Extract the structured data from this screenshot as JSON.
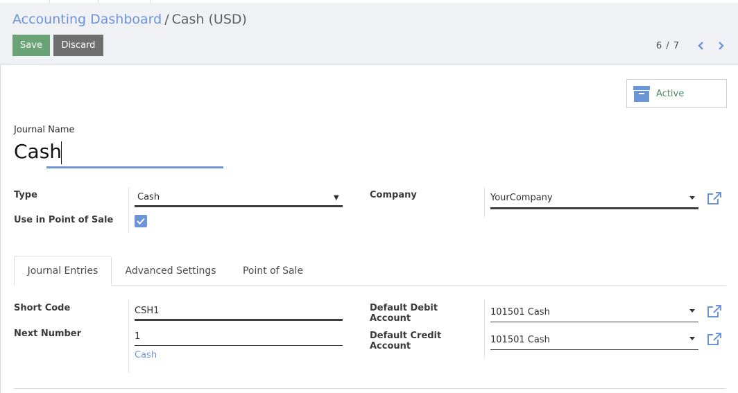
{
  "breadcrumb": {
    "parent": "Accounting Dashboard",
    "separator": "/",
    "current": "Cash (USD)"
  },
  "toolbar": {
    "save_label": "Save",
    "discard_label": "Discard"
  },
  "pager": {
    "value": "6 / 7",
    "prev_icon": "chevron-left-icon",
    "next_icon": "chevron-right-icon"
  },
  "status_button": {
    "label": "Active",
    "icon": "archive-icon"
  },
  "form": {
    "journal_name_label": "Journal Name",
    "journal_name_value": "Cash",
    "type_label": "Type",
    "type_value": "Cash",
    "pos_label": "Use in Point of Sale",
    "pos_checked": true,
    "company_label": "Company",
    "company_value": "YourCompany"
  },
  "tabs": [
    {
      "label": "Journal Entries",
      "active": true
    },
    {
      "label": "Advanced Settings",
      "active": false
    },
    {
      "label": "Point of Sale",
      "active": false
    }
  ],
  "journal_entries": {
    "short_code_label": "Short Code",
    "short_code_value": "CSH1",
    "next_number_label": "Next Number",
    "next_number_value": "1",
    "sequence_link": "Cash",
    "debit_label_line1": "Default Debit",
    "debit_label_line2": "Account",
    "debit_value": "101501 Cash",
    "credit_label_line1": "Default Credit",
    "credit_label_line2": "Account",
    "credit_value": "101501 Cash"
  },
  "colors": {
    "accent": "#6c95d8",
    "save": "#6aa376",
    "discard": "#6f6f6f",
    "active_text": "#4b8a61"
  }
}
